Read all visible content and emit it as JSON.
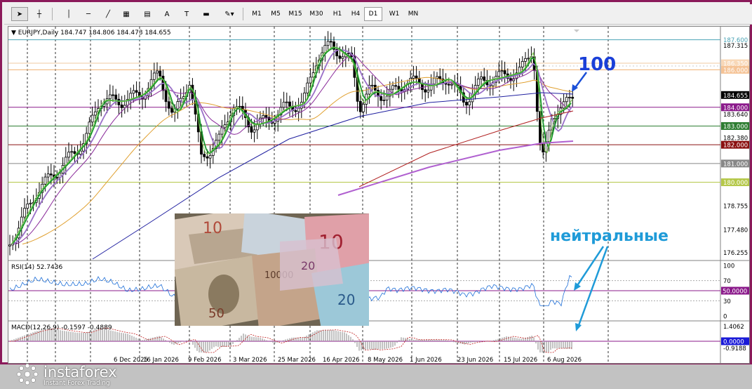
{
  "toolbar": {
    "tools": [
      {
        "name": "cursor-arrow-icon",
        "glyph": "➤"
      },
      {
        "name": "crosshair-icon",
        "glyph": "┼"
      },
      {
        "name": "vertical-line-icon",
        "glyph": "│"
      },
      {
        "name": "horizontal-line-icon",
        "glyph": "─"
      },
      {
        "name": "trendline-icon",
        "glyph": "╱"
      },
      {
        "name": "fibonacci-fan-icon",
        "glyph": "▦"
      },
      {
        "name": "fibonacci-retracement-icon",
        "glyph": "▤"
      },
      {
        "name": "text-icon",
        "glyph": "A"
      },
      {
        "name": "text-label-icon",
        "glyph": "T"
      },
      {
        "name": "rectangle-icon",
        "glyph": "▬"
      },
      {
        "name": "shapes-dropdown-icon",
        "glyph": "✎▾"
      }
    ],
    "timeframes": [
      "M1",
      "M5",
      "M15",
      "M30",
      "H1",
      "H4",
      "D1",
      "W1",
      "MN"
    ],
    "active_timeframe": "D1"
  },
  "main_chart": {
    "header": "EURJPY,Daily  184.747 184.806 184.473 184.655",
    "price_labels": [
      {
        "text": "187.600",
        "bg": "#ffffff",
        "fg": "#4aa3b5",
        "price": 187.6,
        "box": true
      },
      {
        "text": "187.315",
        "bg": "",
        "fg": "#000000",
        "price": 187.315,
        "box": false
      },
      {
        "text": "186.350",
        "bg": "#f8d8b8",
        "fg": "#ffffff",
        "price": 186.35,
        "box": true
      },
      {
        "text": "186.000",
        "bg": "#f5c396",
        "fg": "#ffffff",
        "price": 186.0,
        "box": true
      },
      {
        "text": "184.655",
        "bg": "#000000",
        "fg": "#ffffff",
        "price": 184.655,
        "box": true
      },
      {
        "text": "184.000",
        "bg": "#8b1a8b",
        "fg": "#ffffff",
        "price": 184.0,
        "box": true
      },
      {
        "text": "183.640",
        "bg": "",
        "fg": "#000000",
        "price": 183.64,
        "box": false
      },
      {
        "text": "183.000",
        "bg": "#2e7d32",
        "fg": "#ffffff",
        "price": 183.0,
        "box": true
      },
      {
        "text": "182.380",
        "bg": "",
        "fg": "#000000",
        "price": 182.38,
        "box": false
      },
      {
        "text": "182.000",
        "bg": "#8b1010",
        "fg": "#ffffff",
        "price": 182.0,
        "box": true
      },
      {
        "text": "181.000",
        "bg": "#888888",
        "fg": "#ffffff",
        "price": 181.0,
        "box": true
      },
      {
        "text": "180.000",
        "bg": "#b5c84a",
        "fg": "#ffffff",
        "price": 180.0,
        "box": true
      },
      {
        "text": "178.755",
        "bg": "",
        "fg": "#000000",
        "price": 178.755,
        "box": false
      },
      {
        "text": "177.480",
        "bg": "",
        "fg": "#000000",
        "price": 177.48,
        "box": false
      },
      {
        "text": "176.255",
        "bg": "",
        "fg": "#000000",
        "price": 176.255,
        "box": false
      }
    ],
    "levels": [
      {
        "price": 187.6,
        "color": "#4aa3b5"
      },
      {
        "price": 186.35,
        "color": "#f0c8a0"
      },
      {
        "price": 186.0,
        "color": "#f0b070"
      },
      {
        "price": 184.0,
        "color": "#8b1a8b"
      },
      {
        "price": 183.0,
        "color": "#2e7d32"
      },
      {
        "price": 182.0,
        "color": "#8b1010"
      },
      {
        "price": 181.0,
        "color": "#888888"
      },
      {
        "price": 180.0,
        "color": "#b5c84a"
      }
    ],
    "annotation_number": "100",
    "annotation_text": "нейтральные"
  },
  "rsi": {
    "header": "RSI(14) 52.7436",
    "labels": [
      "100",
      "70",
      "30",
      "0"
    ],
    "level_label": "50.0000"
  },
  "macd": {
    "header": "MACD(12,26,9) -0.1597 -0.4889",
    "labels": [
      "1.4062",
      "-0.9188"
    ],
    "level_label": "0.0000"
  },
  "dates": [
    "6 Dec 2025",
    "16 Jan 2026",
    "9 Feb 2026",
    "3 Mar 2026",
    "25 Mar 2026",
    "16 Apr 2026",
    "8 May 2026",
    "1 Jun 2026",
    "23 Jun 2026",
    "15 Jul 2026",
    "6 Aug 2026"
  ],
  "watermark": {
    "brand": "instaforex",
    "tagline": "Instant Forex Trading"
  },
  "colors": {
    "frame": "#8b1a5a",
    "annotation": "#1f9bd8",
    "arrow": "#1a4fd8",
    "number": "#1a3fd8"
  }
}
